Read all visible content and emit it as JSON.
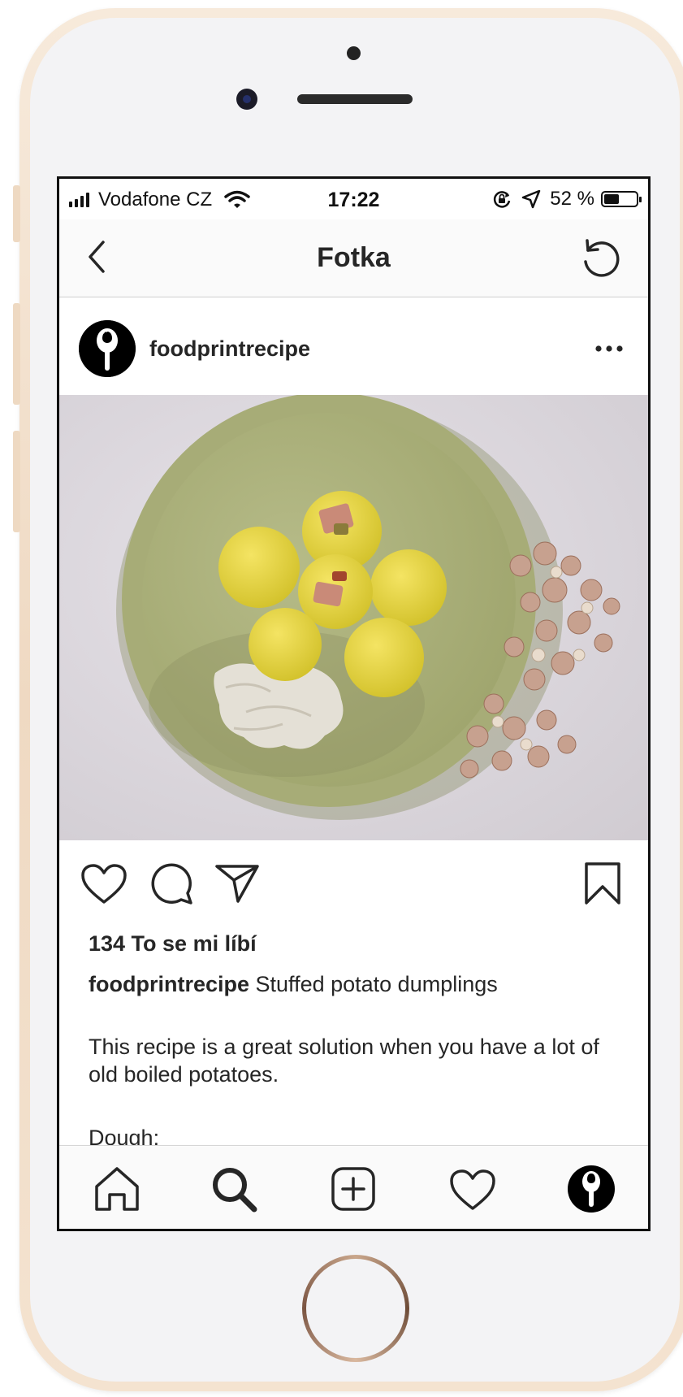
{
  "status_bar": {
    "carrier": "Vodafone CZ",
    "time": "17:22",
    "battery_percent": "52 %",
    "battery_level": 0.52
  },
  "nav": {
    "title": "Fotka"
  },
  "post": {
    "username": "foodprintrecipe",
    "likes": "134 To se mi líbí",
    "caption_user": "foodprintrecipe",
    "caption_title": "Stuffed potato dumplings",
    "body": "This recipe is a great solution when you have a lot of old boiled potatoes.",
    "next_line": "Dough:"
  },
  "icons": {
    "back": "chevron-left-icon",
    "refresh": "refresh-icon",
    "more": "more-icon",
    "like": "heart-icon",
    "comment": "comment-icon",
    "share": "send-icon",
    "save": "bookmark-icon",
    "home": "home-icon",
    "search": "search-icon",
    "add": "add-post-icon",
    "activity": "heart-icon",
    "profile": "avatar"
  },
  "colors": {
    "text": "#262626",
    "frame": "#efd9c2",
    "plate": "#aab07a",
    "dumpling": "#e6d43a"
  }
}
